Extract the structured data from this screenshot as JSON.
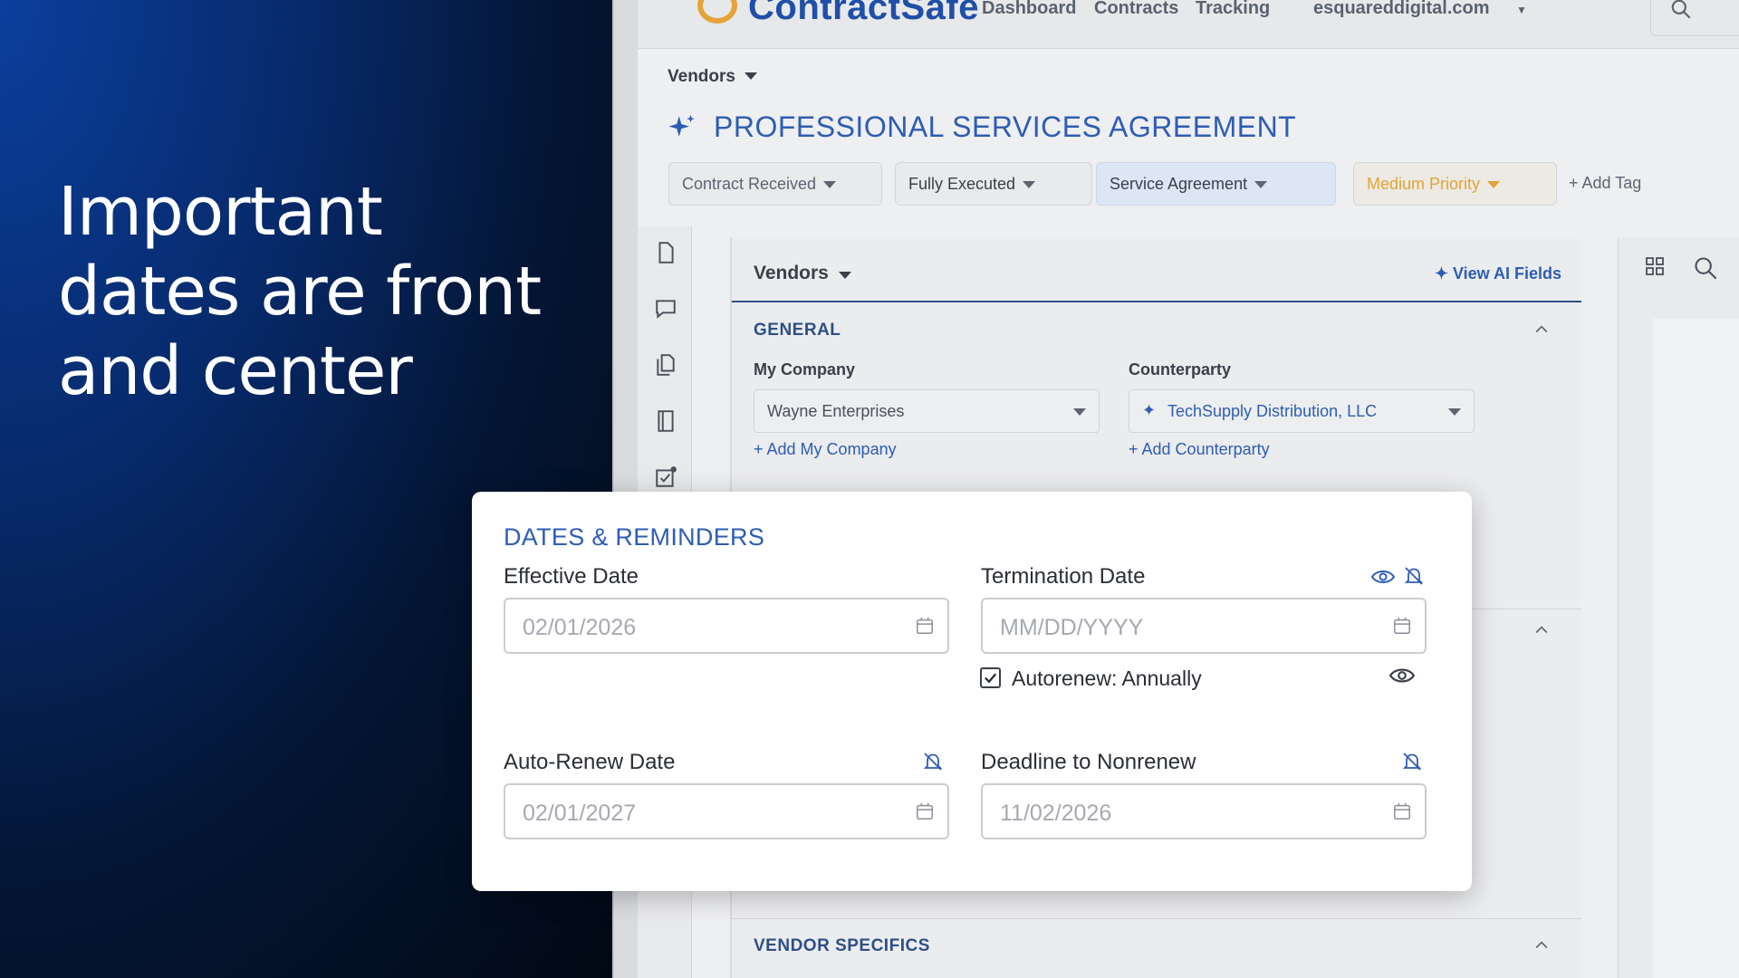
{
  "headline": "Important dates are front and center",
  "app": {
    "brand": "ContractSafe",
    "nav": {
      "dashboard": "Dashboard",
      "contracts": "Contracts",
      "tracking": "Tracking",
      "org": "esquareddigital.com"
    },
    "breadcrumb": "Vendors",
    "page_title": "PROFESSIONAL SERVICES AGREEMENT",
    "chips": {
      "received": "Contract Received",
      "executed": "Fully Executed",
      "type": "Service Agreement",
      "priority": "Medium Priority",
      "add_tag": "Add Tag"
    },
    "vendors_card": {
      "title": "Vendors",
      "view_ai": "View AI Fields",
      "general": "GENERAL",
      "my_company_label": "My Company",
      "my_company_value": "Wayne Enterprises",
      "add_my_company": "Add My Company",
      "counterparty_label": "Counterparty",
      "counterparty_value": "TechSupply Distribution, LLC",
      "add_counterparty": "Add Counterparty",
      "vendor_specifics": "VENDOR SPECIFICS"
    }
  },
  "dates": {
    "title": "DATES & REMINDERS",
    "effective_label": "Effective Date",
    "effective_value": "02/01/2026",
    "termination_label": "Termination Date",
    "termination_placeholder": "MM/DD/YYYY",
    "autorenew_label": "Autorenew: Annually",
    "autorenew_checked": true,
    "auto_renew_label": "Auto-Renew Date",
    "auto_renew_value": "02/01/2027",
    "deadline_label": "Deadline to Nonrenew",
    "deadline_value": "11/02/2026"
  },
  "colors": {
    "accent": "#2e5db3",
    "priority": "#e0a437",
    "brand_orange": "#e5a33a"
  }
}
